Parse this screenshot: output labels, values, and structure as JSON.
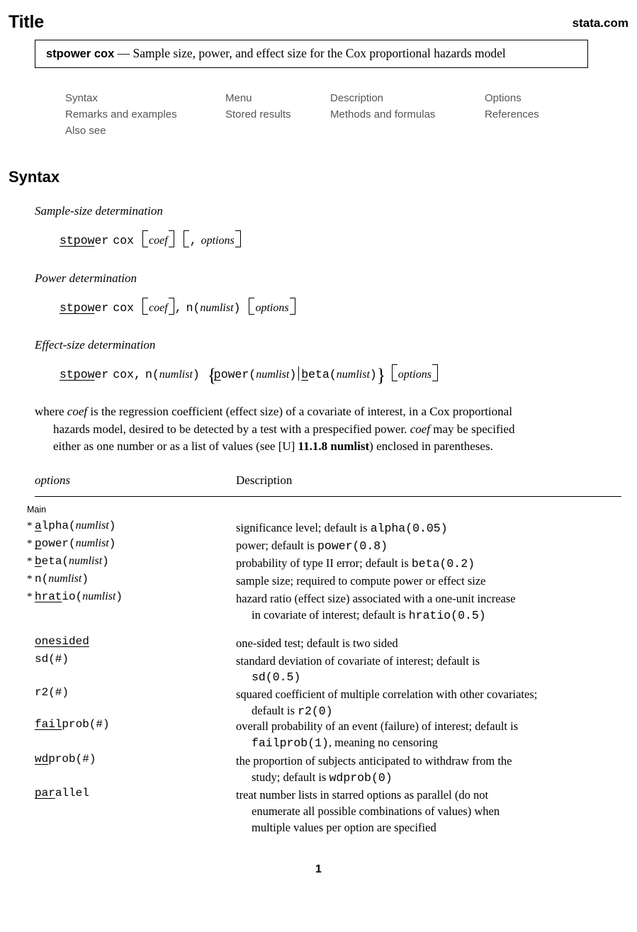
{
  "header": {
    "title": "Title",
    "site": "stata.com"
  },
  "title_box": {
    "command": "stpower cox",
    "dash": " — ",
    "description": "Sample size, power, and effect size for the Cox proportional hazards model"
  },
  "nav": {
    "rows": [
      [
        "Syntax",
        "Menu",
        "Description",
        "Options"
      ],
      [
        "Remarks and examples",
        "Stored results",
        "Methods and formulas",
        "References"
      ],
      [
        "Also see",
        "",
        "",
        ""
      ]
    ]
  },
  "syntax": {
    "heading": "Syntax",
    "blocks": [
      {
        "label": "Sample-size determination",
        "cmd_underlined": "stpow",
        "cmd_rest": "er",
        "cmd_sub": "cox",
        "arg1": "coef",
        "comma": ",",
        "arg2": "options"
      },
      {
        "label": "Power determination",
        "cmd_underlined": "stpow",
        "cmd_rest": "er",
        "cmd_sub": "cox",
        "arg1": "coef",
        "comma": ",",
        "nopt": "n(",
        "numlist": "numlist",
        "nclose": ")",
        "arg2": "options"
      },
      {
        "label": "Effect-size determination",
        "cmd_underlined": "stpow",
        "cmd_rest": "er",
        "cmd_sub": "cox",
        "comma": ",",
        "nopt": "n(",
        "numlist": "numlist",
        "nclose": ")",
        "power_u": "p",
        "power_rest": "ower(",
        "beta_u": "b",
        "beta_rest": "eta(",
        "arg2": "options"
      }
    ]
  },
  "where_paragraph": {
    "line1_a": "where ",
    "coef1": "coef",
    "line1_b": " is the regression coefficient (effect size) of a covariate of interest, in a Cox proportional",
    "line2_a": "hazards model, desired to be detected by a test with a prespecified power. ",
    "coef2": "coef",
    "line2_b": " may be specified",
    "line3_a": "either as one number or as a list of values (see [U] ",
    "ref": "11.1.8 numlist",
    "line3_b": ") enclosed in parentheses."
  },
  "options_table": {
    "col_options": "options",
    "col_description": "Description",
    "subheading": "Main",
    "rows": [
      {
        "star": "*",
        "opt_u": "a",
        "opt_rest": "lpha(",
        "opt_arg": "numlist",
        "opt_close": ")",
        "desc": "significance level; default is ",
        "desc_code": "alpha(0.05)",
        "desc2": "",
        "desc2_code": "",
        "desc2_tail": ""
      },
      {
        "star": "*",
        "opt_u": "p",
        "opt_rest": "ower(",
        "opt_arg": "numlist",
        "opt_close": ")",
        "desc": "power; default is ",
        "desc_code": "power(0.8)",
        "desc2": "",
        "desc2_code": "",
        "desc2_tail": ""
      },
      {
        "star": "*",
        "opt_u": "b",
        "opt_rest": "eta(",
        "opt_arg": "numlist",
        "opt_close": ")",
        "desc": "probability of type II error; default is ",
        "desc_code": "beta(0.2)",
        "desc2": "",
        "desc2_code": "",
        "desc2_tail": ""
      },
      {
        "star": "*",
        "opt_u": "",
        "opt_rest": "n(",
        "opt_arg": "numlist",
        "opt_close": ")",
        "desc": "sample size; required to compute power or effect size",
        "desc_code": "",
        "desc2": "",
        "desc2_code": "",
        "desc2_tail": ""
      },
      {
        "star": "*",
        "opt_u": "hrat",
        "opt_rest": "io(",
        "opt_arg": "numlist",
        "opt_close": ")",
        "desc": "hazard ratio (effect size) associated with a one-unit increase",
        "desc_code": "",
        "desc2": "in covariate of interest; default is ",
        "desc2_code": "hratio(0.5)",
        "desc2_tail": ""
      },
      {
        "star": "",
        "opt_u": "onesided",
        "opt_rest": "",
        "opt_arg": "",
        "opt_close": "",
        "desc": "one-sided test; default is two sided",
        "desc_code": "",
        "desc2": "",
        "desc2_code": "",
        "desc2_tail": ""
      },
      {
        "star": "",
        "opt_u": "",
        "opt_rest": "sd(#)",
        "opt_arg": "",
        "opt_close": "",
        "desc": "standard deviation of covariate of interest; default is",
        "desc_code": "",
        "desc2": "",
        "desc2_code": "sd(0.5)",
        "desc2_tail": ""
      },
      {
        "star": "",
        "opt_u": "",
        "opt_rest": "r2(#)",
        "opt_arg": "",
        "opt_close": "",
        "desc": "squared coefficient of multiple correlation with other covariates;",
        "desc_code": "",
        "desc2": "default is ",
        "desc2_code": "r2(0)",
        "desc2_tail": ""
      },
      {
        "star": "",
        "opt_u": "fail",
        "opt_rest": "prob(#)",
        "opt_arg": "",
        "opt_close": "",
        "desc": "overall probability of an event (failure) of interest; default is",
        "desc_code": "",
        "desc2": "",
        "desc2_code": "failprob(1)",
        "desc2_tail": ", meaning no censoring"
      },
      {
        "star": "",
        "opt_u": "wd",
        "opt_rest": "prob(#)",
        "opt_arg": "",
        "opt_close": "",
        "desc": "the proportion of subjects anticipated to withdraw from the",
        "desc_code": "",
        "desc2": "study; default is ",
        "desc2_code": "wdprob(0)",
        "desc2_tail": ""
      },
      {
        "star": "",
        "opt_u": "par",
        "opt_rest": "allel",
        "opt_arg": "",
        "opt_close": "",
        "desc": "treat number lists in starred options as parallel (do not",
        "desc_code": "",
        "desc2": "enumerate all possible combinations of values) when",
        "desc2_code": "",
        "desc2_tail": "multiple values per option are specified"
      }
    ]
  },
  "footer": {
    "page_number": "1"
  }
}
